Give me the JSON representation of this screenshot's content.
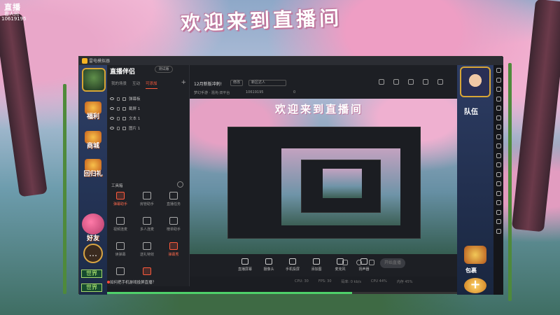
{
  "overlay": {
    "logo": "直播",
    "tag": "看人间",
    "id": "10619195",
    "big_title": "欢迎来到直播间"
  },
  "titlebar": {
    "text": "雷电模拟器"
  },
  "game_left": {
    "welfare": "福利",
    "mall": "商城",
    "return_gift": "回归礼",
    "friends": "好友",
    "chat_icon": "chat-bubble-icon",
    "world1": "世界",
    "world2": "世界"
  },
  "panel": {
    "logo": "直播伴侣",
    "version": "测试版",
    "tabs": [
      "我的场景",
      "互动",
      "可添加"
    ],
    "add": "+",
    "sources": [
      {
        "name": "弹幕板"
      },
      {
        "name": "截屏 1"
      },
      {
        "name": "文本 1"
      },
      {
        "name": "图片 1"
      }
    ],
    "tools_header": "工具箱",
    "tools": [
      {
        "label": "弹幕助手"
      },
      {
        "label": "房管助手"
      },
      {
        "label": "直播任务"
      },
      {
        "label": "视频连麦"
      },
      {
        "label": "多人连麦"
      },
      {
        "label": "榜单助手"
      },
      {
        "label": "读弹幕"
      },
      {
        "label": "送礼特效"
      },
      {
        "label": "弹幕秀"
      },
      {
        "label": "…"
      },
      {
        "label": "…"
      },
      {
        "label": "…"
      }
    ],
    "tip": "如何把手机游戏投屏直播？"
  },
  "header": {
    "title": "12月新版冲刺!",
    "edit": "修改",
    "area": "新区达人",
    "sub": "梦幻手游 · 混沌·双平台",
    "open_live": "开直播时间",
    "room_id": "10619195",
    "fire": "0"
  },
  "preview": {
    "title": "欢迎来到直播间"
  },
  "toolbar": {
    "buttons": [
      "直播屏幕",
      "摄像头",
      "手机投屏",
      "添加图",
      "麦克风",
      "扬声器"
    ],
    "start": "开始直播"
  },
  "status": [
    "CPU: 30",
    "FPS: 30",
    "码率: 0 kb/s",
    "CPU 44%",
    "内存 45%"
  ],
  "game_right": {
    "team": "队伍",
    "pack": "包裹",
    "plus": "+"
  },
  "colors": {
    "accent": "#ff5a3c",
    "progress": "#4fd06a"
  }
}
